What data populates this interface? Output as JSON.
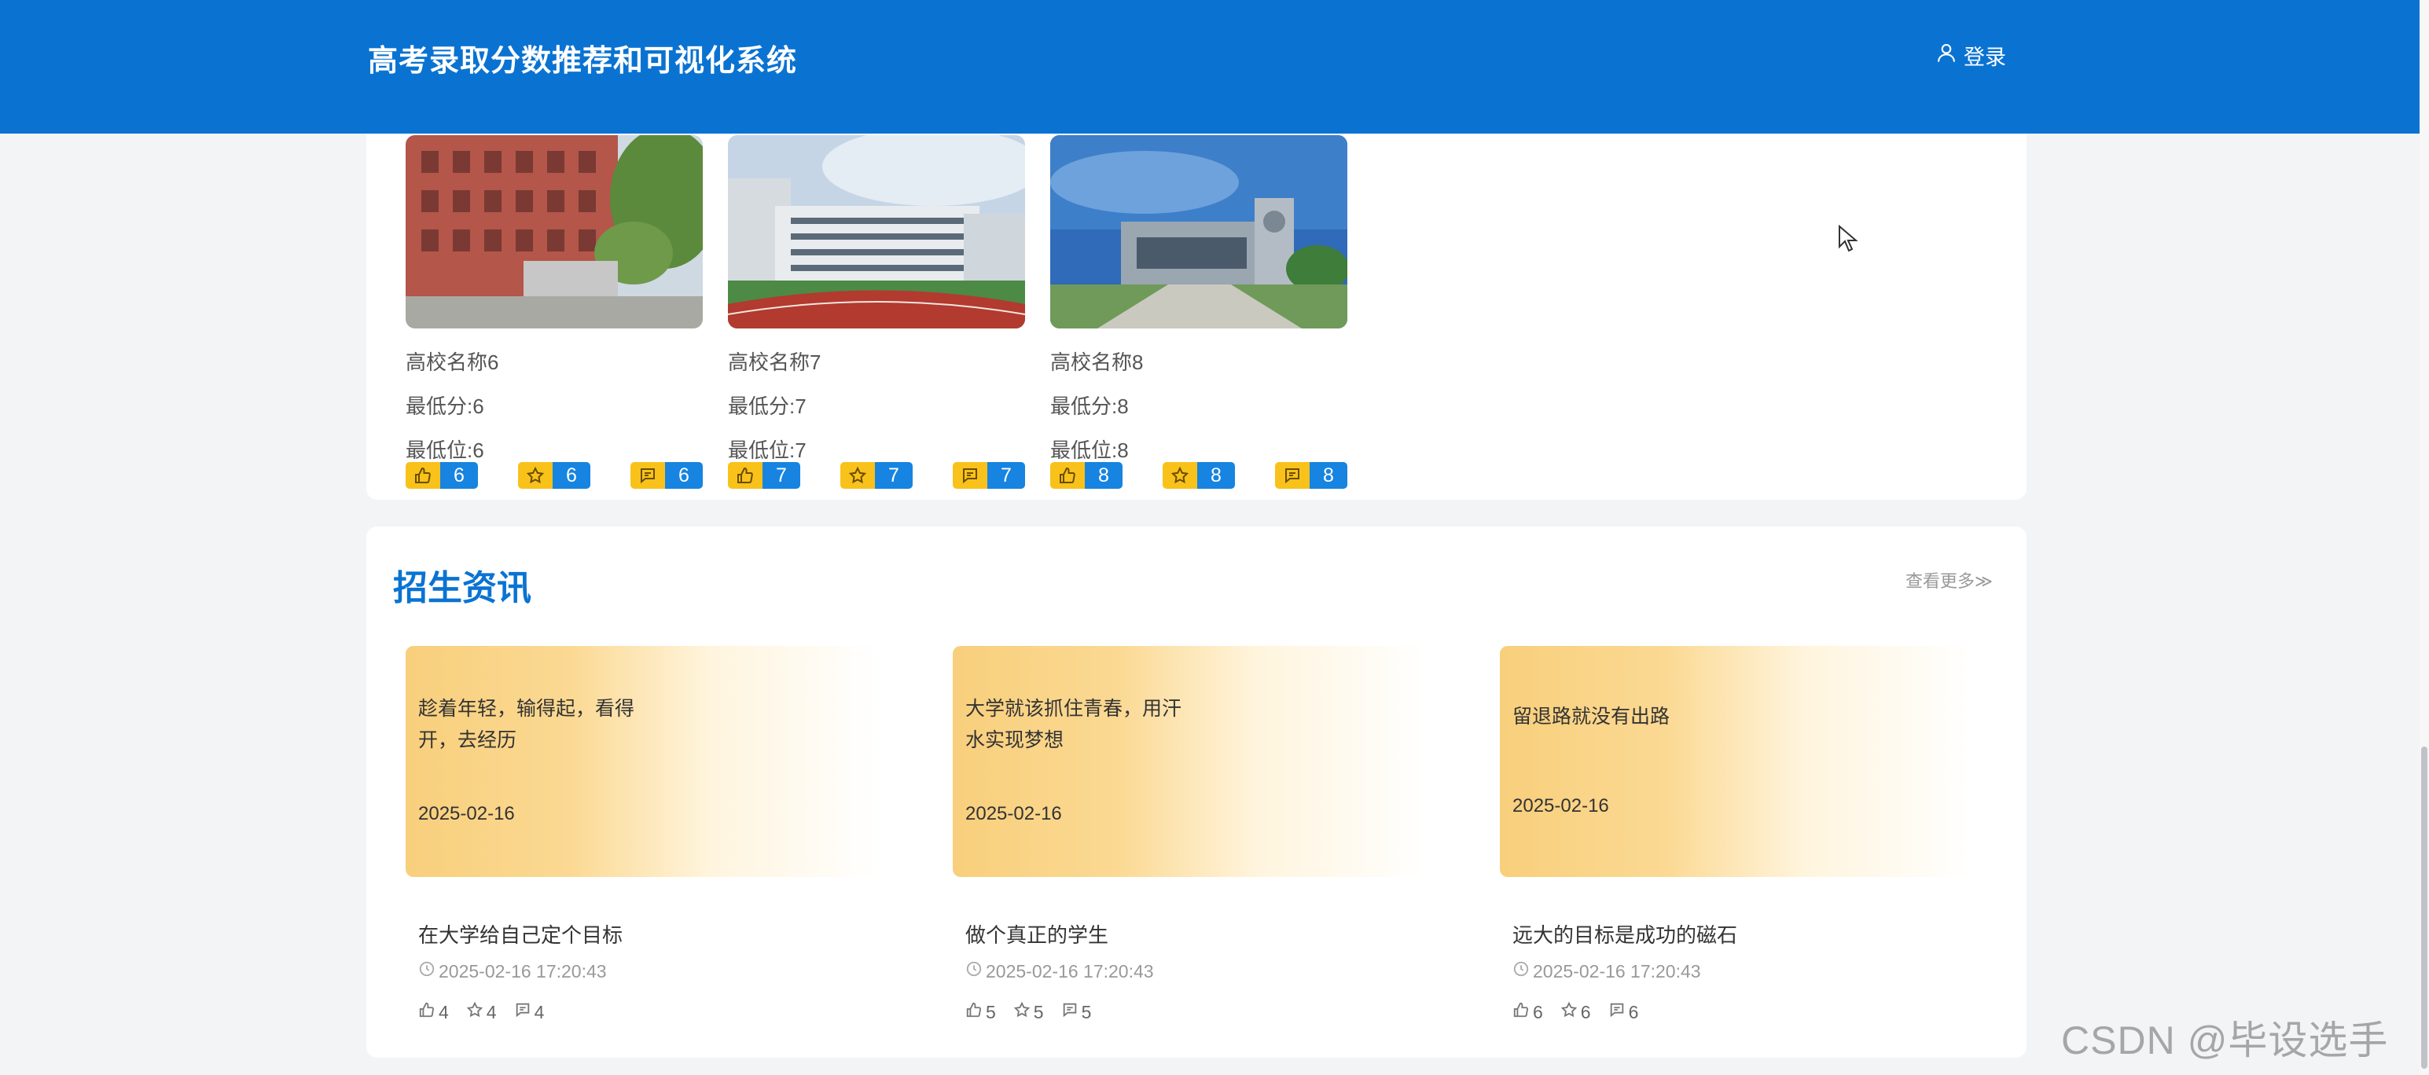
{
  "header": {
    "brand": "高考录取分数推荐和可视化系统",
    "login_label": "登录"
  },
  "schools": [
    {
      "name": "高校名称6",
      "min_score": "最低分:6",
      "min_rank": "最低位:6",
      "likes": "6",
      "favorites": "6",
      "comments": "6"
    },
    {
      "name": "高校名称7",
      "min_score": "最低分:7",
      "min_rank": "最低位:7",
      "likes": "7",
      "favorites": "7",
      "comments": "7"
    },
    {
      "name": "高校名称8",
      "min_score": "最低分:8",
      "min_rank": "最低位:8",
      "likes": "8",
      "favorites": "8",
      "comments": "8"
    }
  ],
  "news_section": {
    "title": "招生资讯",
    "more_label": "查看更多≫",
    "items": [
      {
        "cover_text": "趁着年轻，输得起，看得开，去经历",
        "cover_date": "2025-02-16",
        "title": "在大学给自己定个目标",
        "time": "2025-02-16 17:20:43",
        "likes": "4",
        "favorites": "4",
        "comments": "4"
      },
      {
        "cover_text": "大学就该抓住青春，用汗水实现梦想",
        "cover_date": "2025-02-16",
        "title": "做个真正的学生",
        "time": "2025-02-16 17:20:43",
        "likes": "5",
        "favorites": "5",
        "comments": "5"
      },
      {
        "cover_text": "留退路就没有出路",
        "cover_date": "2025-02-16",
        "title": "远大的目标是成功的磁石",
        "time": "2025-02-16 17:20:43",
        "likes": "6",
        "favorites": "6",
        "comments": "6"
      }
    ]
  },
  "watermark": "CSDN @毕设选手",
  "colors": {
    "primary": "#0a73d2",
    "badge_icon": "#f8c21b",
    "badge_count": "#1684e0",
    "cover_gradient": "#f8cf7c"
  },
  "icons": {
    "user": "user-icon",
    "like": "thumbs-up-icon",
    "favorite": "star-icon",
    "comment": "comment-icon",
    "clock": "clock-icon"
  }
}
